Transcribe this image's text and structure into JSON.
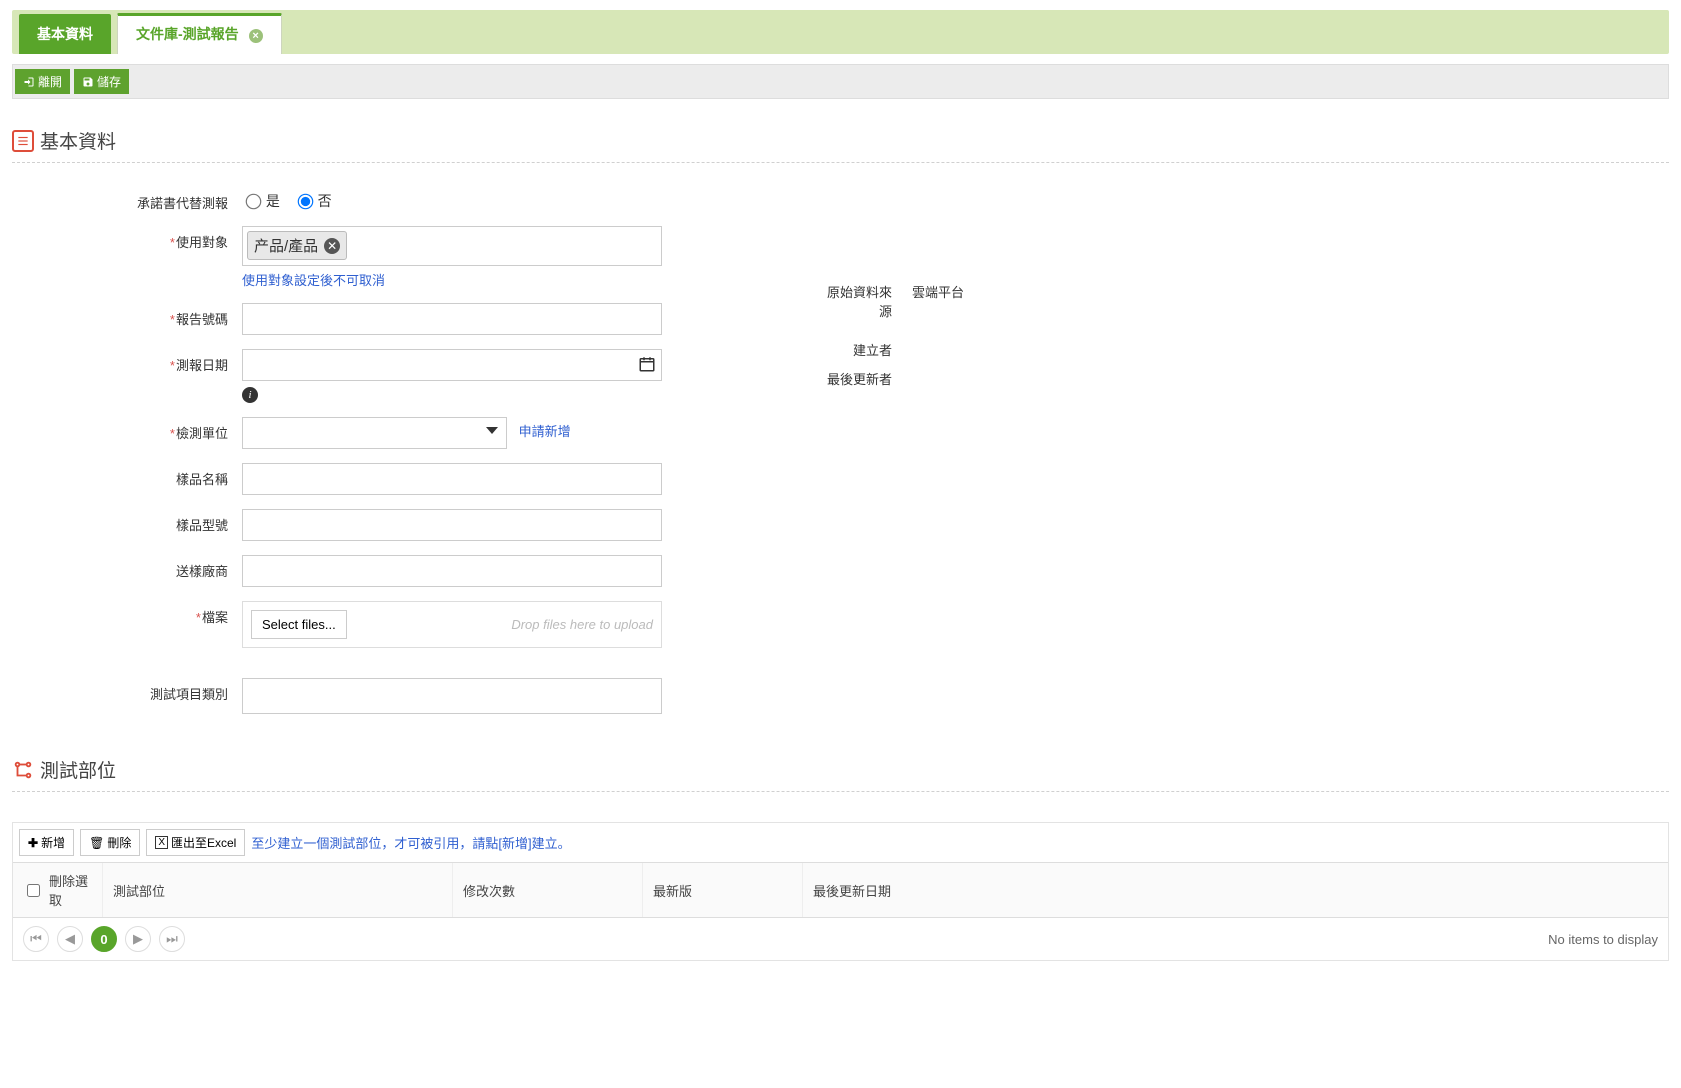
{
  "tabs": {
    "basic": "基本資料",
    "active": "文件庫-測試報告"
  },
  "actions": {
    "leave": "離開",
    "save": "儲存"
  },
  "section1": {
    "title": "基本資料"
  },
  "form": {
    "commitment_label": "承諾書代替測報",
    "yes": "是",
    "no": "否",
    "usage_label": "使用對象",
    "usage_chip": "产品/產品",
    "usage_hint": "使用對象設定後不可取消",
    "report_no_label": "報告號碼",
    "report_date_label": "測報日期",
    "unit_label": "檢測單位",
    "unit_link": "申請新增",
    "sample_name_label": "樣品名稱",
    "sample_model_label": "樣品型號",
    "vendor_label": "送樣廠商",
    "file_label": "檔案",
    "select_files": "Select files...",
    "drop_hint": "Drop files here to upload",
    "category_label": "測試項目類別"
  },
  "right": {
    "source_label": "原始資料來源",
    "source_value": "雲端平台",
    "creator_label": "建立者",
    "creator_value": "",
    "updater_label": "最後更新者",
    "updater_value": ""
  },
  "section2": {
    "title": "測試部位"
  },
  "grid": {
    "btn_add": "新增",
    "btn_delete": "刪除",
    "btn_export": "匯出至Excel",
    "msg": "至少建立一個測試部位，才可被引用，請點[新增]建立。",
    "col_delsel": "刪除選取",
    "col_part": "測試部位",
    "col_rev": "修改次數",
    "col_latest": "最新版",
    "col_lastdate": "最後更新日期",
    "page_num": "0",
    "no_items": "No items to display"
  }
}
